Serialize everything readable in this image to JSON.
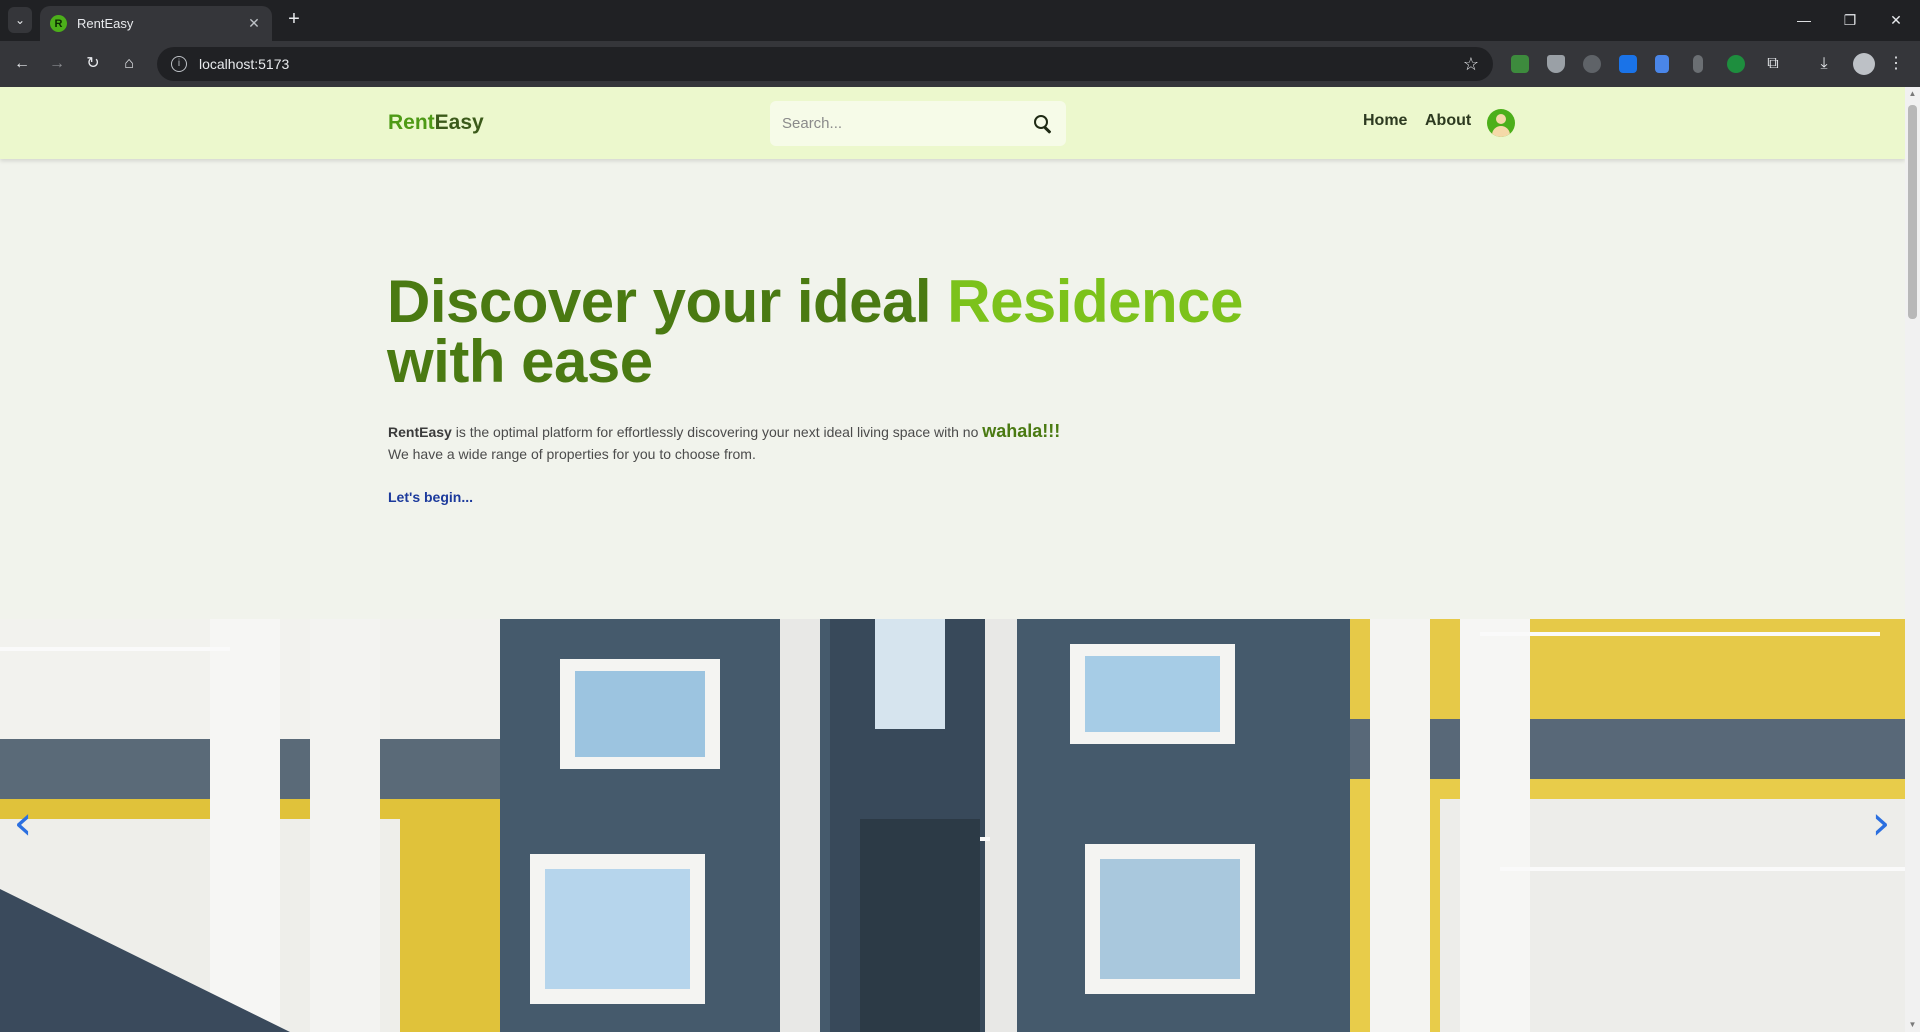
{
  "browser": {
    "tab_title": "RentEasy",
    "tab_favicon_letter": "R",
    "url": "localhost:5173"
  },
  "header": {
    "logo_part1": "Rent",
    "logo_part2": "Easy",
    "search_placeholder": "Search...",
    "nav": {
      "home": "Home",
      "about": "About"
    }
  },
  "hero": {
    "title_line1_a": "Discover your ideal ",
    "title_line1_accent": "Residence",
    "title_line2": "with ease",
    "desc_brand": "RentEasy",
    "desc_middle": " is the optimal platform for effortlessly discovering your next ideal living space with no ",
    "desc_emphasis": "wahala!!!",
    "desc_line2": "We have a wide range of properties for you to choose from.",
    "cta_label": "Let's begin..."
  },
  "carousel": {
    "prev_icon": "chevron-left-icon",
    "next_icon": "chevron-right-icon",
    "image_subject": "apartment-building-photo"
  },
  "colors": {
    "header_bg": "#ecf8cd",
    "brand_green": "#4a7a12",
    "accent_green": "#7cc21b",
    "page_bg": "#f1f3ec",
    "link_blue": "#1c3a9c"
  }
}
